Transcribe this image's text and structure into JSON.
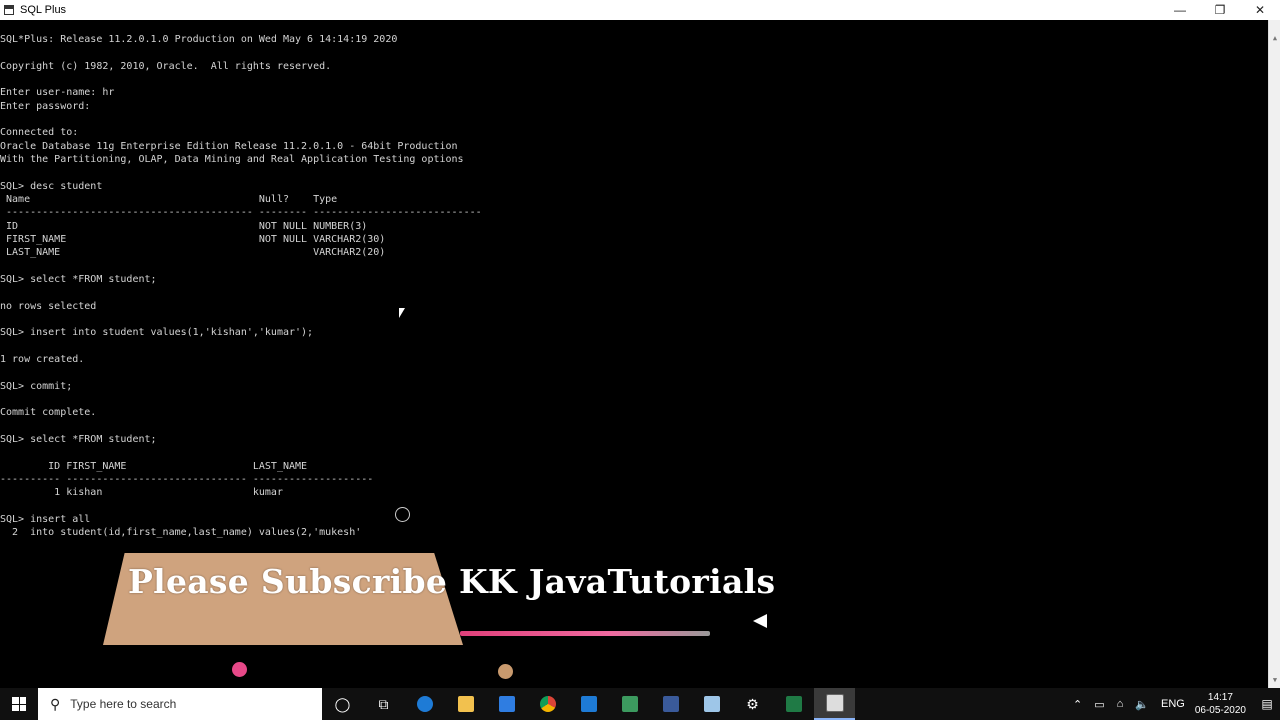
{
  "window": {
    "title": "SQL Plus",
    "minimize_glyph": "—",
    "restore_glyph": "❐",
    "close_glyph": "✕"
  },
  "console": {
    "text": "SQL*Plus: Release 11.2.0.1.0 Production on Wed May 6 14:14:19 2020\n\nCopyright (c) 1982, 2010, Oracle.  All rights reserved.\n\nEnter user-name: hr\nEnter password:\n\nConnected to:\nOracle Database 11g Enterprise Edition Release 11.2.0.1.0 - 64bit Production\nWith the Partitioning, OLAP, Data Mining and Real Application Testing options\n\nSQL> desc student\n Name                                      Null?    Type\n ----------------------------------------- -------- ----------------------------\n ID                                        NOT NULL NUMBER(3)\n FIRST_NAME                                NOT NULL VARCHAR2(30)\n LAST_NAME                                          VARCHAR2(20)\n\nSQL> select *FROM student;\n\nno rows selected\n\nSQL> insert into student values(1,'kishan','kumar');\n\n1 row created.\n\nSQL> commit;\n\nCommit complete.\n\nSQL> select *FROM student;\n\n        ID FIRST_NAME                     LAST_NAME\n---------- ------------------------------ --------------------\n         1 kishan                         kumar\n\nSQL> insert all\n  2  into student(id,first_name,last_name) values(2,'mukesh'"
  },
  "overlay": {
    "banner_text": "Please Subscribe KK JavaTutorials",
    "banner_color": "#cfa37e",
    "accent_color": "#e64888"
  },
  "taskbar": {
    "search_placeholder": "Type here to search",
    "icons": [
      "cortana-icon",
      "task-view-icon",
      "edge-icon",
      "file-explorer-icon",
      "store-icon",
      "chrome-icon",
      "mail-icon",
      "app-icon",
      "app2-icon",
      "notepad-icon",
      "settings-icon",
      "excel-icon",
      "sqlplus-icon"
    ],
    "tray": {
      "language": "ENG",
      "time": "14:17",
      "date": "06-05-2020"
    }
  }
}
